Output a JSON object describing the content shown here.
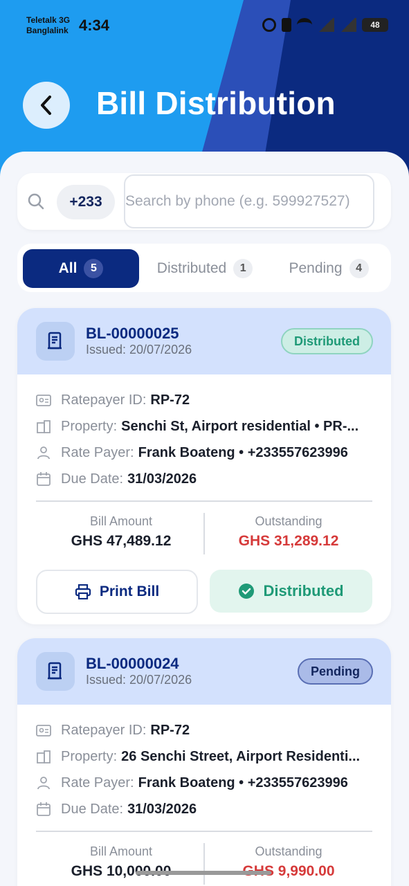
{
  "status_bar": {
    "carrier1": "Teletalk 3G",
    "carrier2": "Banglalink",
    "time": "4:34",
    "battery": "48"
  },
  "header": {
    "title": "Bill Distribution",
    "back_icon": "chevron-left-icon"
  },
  "search": {
    "country_code": "+233",
    "placeholder": "Search by phone (e.g. 599927527)",
    "value": ""
  },
  "tabs": [
    {
      "label": "All",
      "count": "5",
      "active": true
    },
    {
      "label": "Distributed",
      "count": "1",
      "active": false
    },
    {
      "label": "Pending",
      "count": "4",
      "active": false
    }
  ],
  "bills": [
    {
      "bill_no": "BL-00000025",
      "issued": "Issued: 20/07/2026",
      "status": "Distributed",
      "ratepayer_id_label": "Ratepayer ID:",
      "ratepayer_id": "RP-72",
      "property_label": "Property:",
      "property": "Senchi St, Airport residential • PR-...",
      "rate_payer_label": "Rate Payer:",
      "rate_payer": "Frank Boateng • +233557623996",
      "due_label": "Due Date:",
      "due_date": "31/03/2026",
      "bill_amount_label": "Bill Amount",
      "bill_amount": "GHS 47,489.12",
      "outstanding_label": "Outstanding",
      "outstanding": "GHS 31,289.12",
      "print_label": "Print Bill",
      "action_label": "Distributed"
    },
    {
      "bill_no": "BL-00000024",
      "issued": "Issued: 20/07/2026",
      "status": "Pending",
      "ratepayer_id_label": "Ratepayer ID:",
      "ratepayer_id": "RP-72",
      "property_label": "Property:",
      "property": "26 Senchi Street, Airport Residenti...",
      "rate_payer_label": "Rate Payer:",
      "rate_payer": "Frank Boateng • +233557623996",
      "due_label": "Due Date:",
      "due_date": "31/03/2026",
      "bill_amount_label": "Bill Amount",
      "bill_amount": "GHS 10,000.00",
      "outstanding_label": "Outstanding",
      "outstanding": "GHS 9,990.00"
    }
  ],
  "colors": {
    "primary": "#0b2a80",
    "sky": "#1e9cf0",
    "success": "#1f9a77",
    "danger": "#d63a3a"
  }
}
